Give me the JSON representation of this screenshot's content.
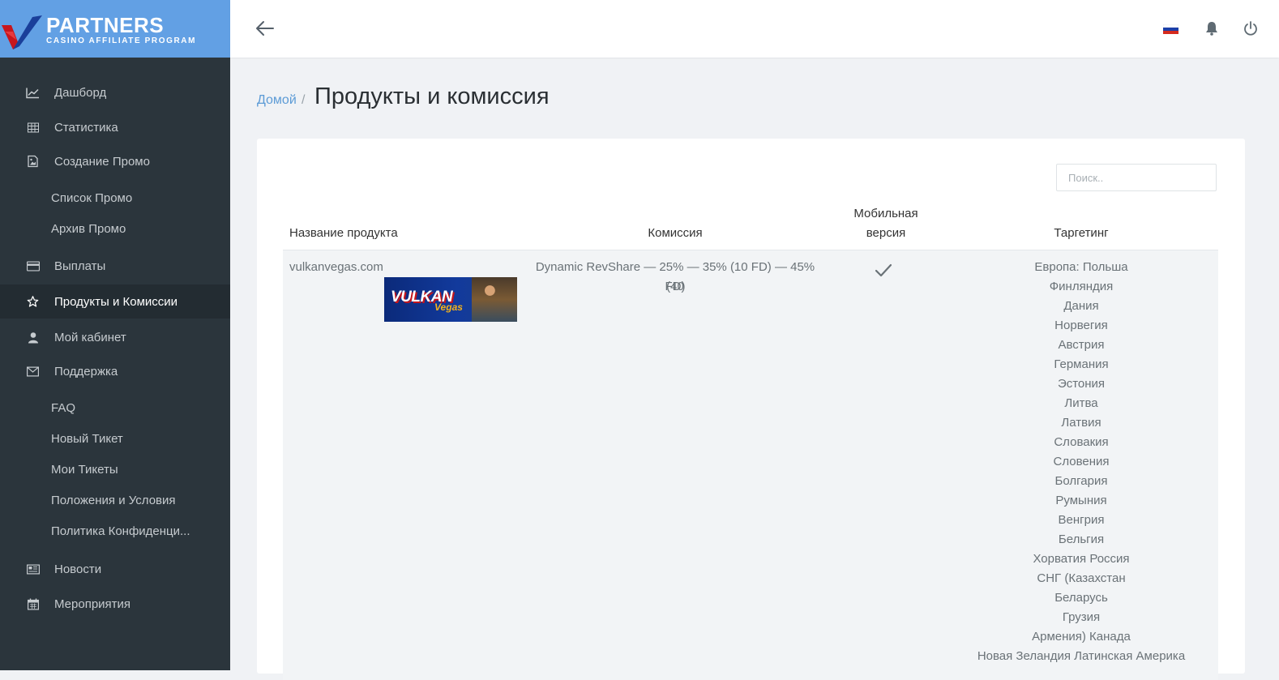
{
  "brand": {
    "title": "PARTNERS",
    "subtitle": "CASINO AFFILIATE PROGRAM"
  },
  "sidebar": {
    "items": [
      {
        "label": "Дашборд",
        "icon": "chart-line-icon"
      },
      {
        "label": "Статистика",
        "icon": "table-grid-icon"
      },
      {
        "label": "Создание Промо",
        "icon": "image-file-icon"
      },
      {
        "label": "Список Промо"
      },
      {
        "label": "Архив Промо"
      },
      {
        "label": "Выплаты",
        "icon": "credit-card-icon"
      },
      {
        "label": "Продукты и Комиссии",
        "icon": "star-icon",
        "active": true
      },
      {
        "label": "Мой кабинет",
        "icon": "user-icon"
      },
      {
        "label": "Поддержка",
        "icon": "envelope-icon"
      },
      {
        "label": "FAQ"
      },
      {
        "label": "Новый Тикет"
      },
      {
        "label": "Мои Тикеты"
      },
      {
        "label": "Положения и Условия"
      },
      {
        "label": "Политика Конфиденци..."
      },
      {
        "label": "Новости",
        "icon": "newspaper-icon"
      },
      {
        "label": "Мероприятия",
        "icon": "calendar-icon"
      }
    ]
  },
  "header": {
    "back_icon": "arrow-left-icon",
    "flag_icon": "russia-flag-icon",
    "bell_icon": "bell-icon",
    "power_icon": "power-icon"
  },
  "breadcrumb": {
    "home": "Домой",
    "separator": "/",
    "current": "Продукты и комиссия"
  },
  "search": {
    "placeholder": "Поиск.."
  },
  "table": {
    "headers": {
      "product": "Название продукта",
      "commission": "Комиссия",
      "mobile_line1": "Мобильная",
      "mobile_line2": "версия",
      "targeting": "Таргетинг"
    },
    "rows": [
      {
        "product": "vulkanvegas.com",
        "banner_text": "VULKAN",
        "banner_sub": "Vegas",
        "commission_line1": "Dynamic RevShare — 25% — 35% (10 FD) — 45% (40",
        "commission_line2": "FD)",
        "mobile": "check-icon",
        "targeting": [
          "Европа: Польша",
          "Финляндия",
          "Дания",
          "Норвегия",
          "Австрия",
          "Германия",
          "Эстония",
          "Литва",
          "Латвия",
          "Словакия",
          "Словения",
          "Болгария",
          "Румыния",
          "Венгрия",
          "Бельгия",
          "Хорватия Россия",
          "СНГ (Казахстан",
          "Беларусь",
          "Грузия",
          "Армения) Канада",
          "Новая Зеландия Латинская Америка"
        ]
      }
    ]
  },
  "colors": {
    "sidebar_bg": "#2b353c",
    "brand_bg": "#62a0e4",
    "link": "#5c9bd6",
    "row_bg": "#f2f4f6"
  }
}
